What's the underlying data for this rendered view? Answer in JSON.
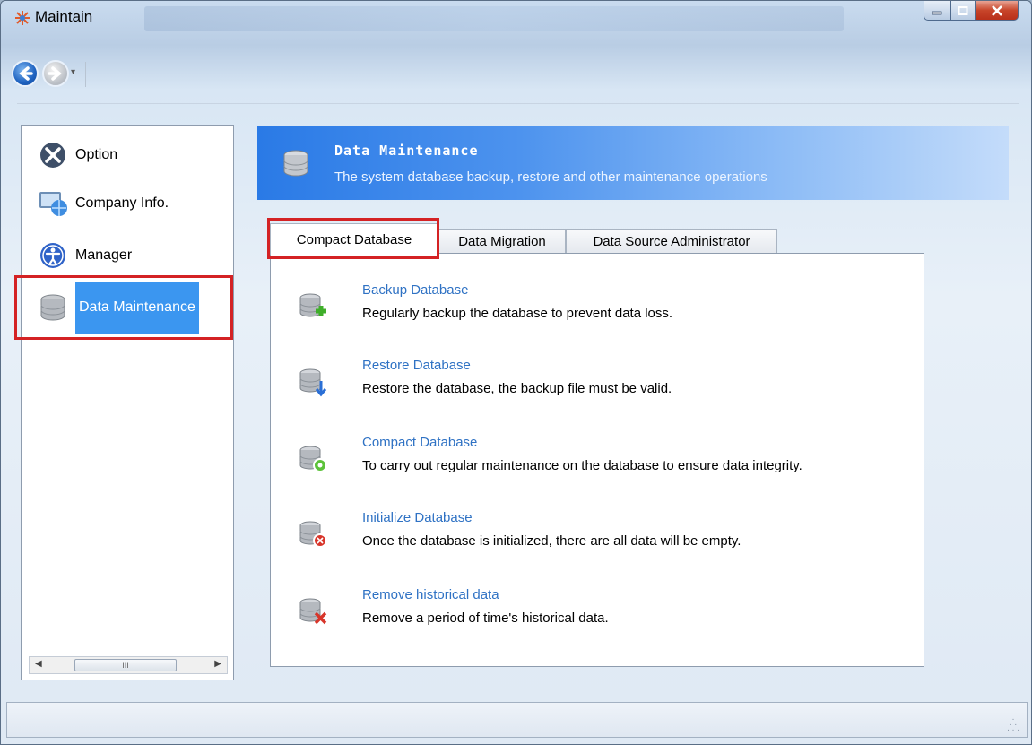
{
  "window": {
    "title": "Maintain",
    "app_icon": "maintain-app-icon",
    "controls": {
      "minimize": "minimize-icon",
      "maximize": "maximize-icon",
      "close": "close-icon"
    }
  },
  "nav": {
    "back_icon": "back-arrow-icon",
    "forward_icon": "forward-arrow-icon",
    "dropdown": "▾"
  },
  "sidebar": {
    "items": [
      {
        "label": "Option",
        "icon": "wrench-screwdriver-icon"
      },
      {
        "label": "Company Info.",
        "icon": "company-globe-icon"
      },
      {
        "label": "Manager",
        "icon": "user-circle-icon"
      },
      {
        "label": "Data Maintenance",
        "icon": "database-icon",
        "selected": true
      }
    ],
    "scroll_thumb": "III"
  },
  "header": {
    "title": "Data Maintenance",
    "subtitle": "The system database backup, restore and other maintenance operations",
    "icon": "database-icon"
  },
  "tabs": [
    {
      "label": "Compact Database",
      "active": true
    },
    {
      "label": "Data Migration",
      "active": false
    },
    {
      "label": "Data Source Administrator",
      "active": false
    }
  ],
  "tasks": [
    {
      "link": "Backup Database",
      "desc": "Regularly backup the database to prevent data loss.",
      "icon": "database-add-icon",
      "accent": "#3fae2a"
    },
    {
      "link": "Restore Database",
      "desc": "Restore the database, the backup file must be valid.",
      "icon": "database-restore-icon",
      "accent": "#2a6fd6"
    },
    {
      "link": "Compact Database",
      "desc": "To carry out regular maintenance on the database to ensure data integrity.",
      "icon": "database-compact-icon",
      "accent": "#5cc23a"
    },
    {
      "link": "Initialize Database",
      "desc": "Once the database is initialized, there are all data will be empty.",
      "icon": "database-initialize-icon",
      "accent": "#d8352a"
    },
    {
      "link": "Remove historical data",
      "desc": "Remove a period of time's historical data.",
      "icon": "database-remove-icon",
      "accent": "#d8352a"
    }
  ],
  "colors": {
    "link": "#2f72c4",
    "selection": "#3b96f0",
    "highlight_box": "#d42224",
    "header_start": "#2a7ae6"
  }
}
